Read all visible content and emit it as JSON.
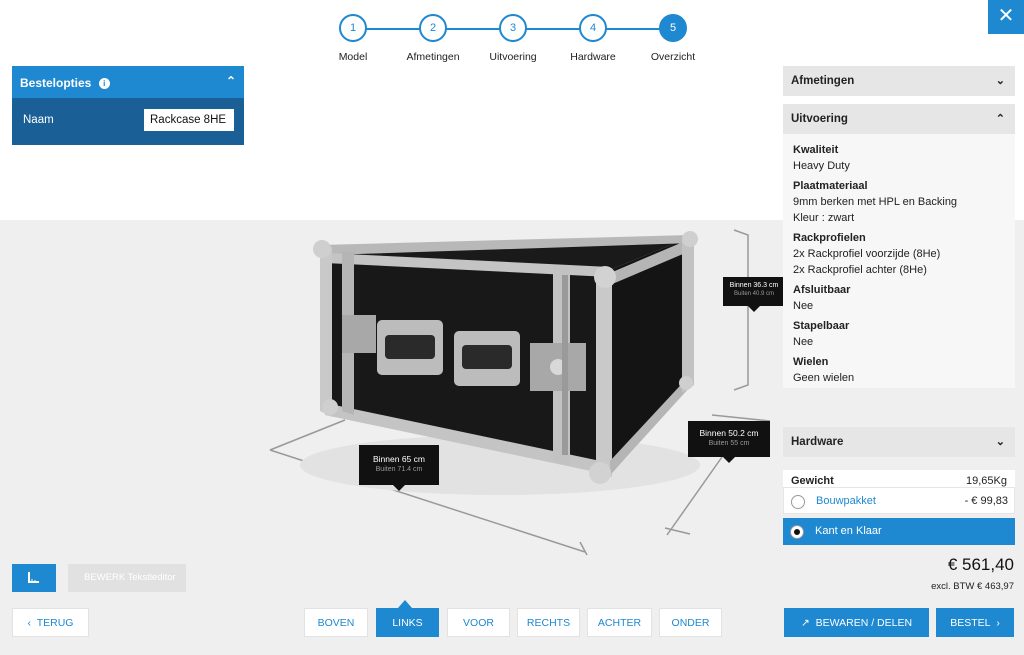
{
  "stepper": {
    "steps": [
      {
        "num": "1",
        "label": "Model"
      },
      {
        "num": "2",
        "label": "Afmetingen"
      },
      {
        "num": "3",
        "label": "Uitvoering"
      },
      {
        "num": "4",
        "label": "Hardware"
      },
      {
        "num": "5",
        "label": "Overzicht"
      }
    ],
    "active": 5
  },
  "close_icon": "✕",
  "bestelopties": {
    "title": "Bestelopties",
    "info_icon": "i",
    "chevron_icon": "⌃",
    "naam_label": "Naam",
    "naam_value": "Rackcase 8HE"
  },
  "right_panel": {
    "afmetingen": "Afmetingen",
    "uitvoering": "Uitvoering",
    "specs": [
      {
        "title": "Kwaliteit",
        "values": [
          "Heavy Duty"
        ]
      },
      {
        "title": "Plaatmateriaal",
        "values": [
          "9mm berken met HPL en Backing",
          "Kleur : zwart"
        ]
      },
      {
        "title": "Rackprofielen",
        "values": [
          "2x Rackprofiel voorzijde (8He)",
          "2x Rackprofiel achter (8He)"
        ]
      },
      {
        "title": "Afsluitbaar",
        "values": [
          "Nee"
        ]
      },
      {
        "title": "Stapelbaar",
        "values": [
          "Nee"
        ]
      },
      {
        "title": "Wielen",
        "values": [
          "Geen wielen"
        ]
      }
    ],
    "hardware": "Hardware",
    "gewicht_label": "Gewicht",
    "gewicht_value": "19,65Kg",
    "options": [
      {
        "label": "Bouwpakket",
        "price": "- € 99,83",
        "selected": false
      },
      {
        "label": "Kant en Klaar",
        "price": "",
        "selected": true
      }
    ],
    "total": "€ 561,40",
    "excl": "excl. BTW € 463,97"
  },
  "dimensions": {
    "height": {
      "binnen": "Binnen 36.3 cm",
      "buiten": "Buiten 40.9 cm"
    },
    "depth": {
      "binnen": "Binnen 50.2 cm",
      "buiten": "Buiten 55 cm"
    },
    "width": {
      "binnen": "Binnen 65 cm",
      "buiten": "Buiten 71.4 cm"
    }
  },
  "toolbar": {
    "ruler_icon": "ruler-icon",
    "bewerk_label": "BEWERK Tekstleditor",
    "terug": "TERUG",
    "views": [
      "BOVEN",
      "LINKS",
      "VOOR",
      "RECHTS",
      "ACHTER",
      "ONDER"
    ],
    "active_view": "LINKS",
    "bewaren": "BEWAREN / DELEN",
    "bestel": "BESTEL"
  },
  "colors": {
    "accent": "#1e88d1",
    "panel_dark": "#1a5f96"
  }
}
